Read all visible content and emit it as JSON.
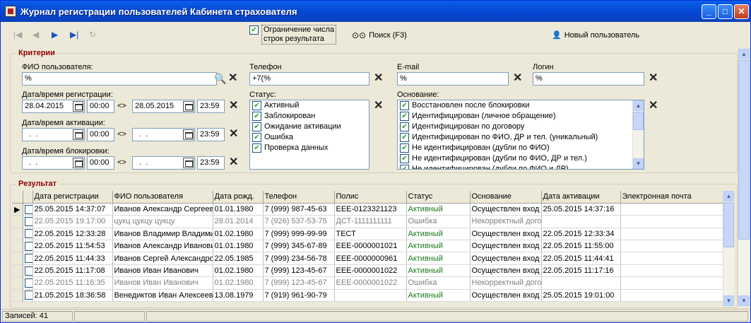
{
  "window": {
    "title": "Журнал регистрации пользователей Кабинета страхователя"
  },
  "toolbar": {
    "limit_label_1": "Ограничение числа",
    "limit_label_2": "строк результата",
    "limit_checked": true,
    "search_label": "Поиск (F3)",
    "new_user_label": "Новый пользователь"
  },
  "criteria": {
    "title": "Критерии",
    "fio_label": "ФИО пользователя:",
    "fio_value": "%",
    "phone_label": "Телефон",
    "phone_value": "+7(%",
    "email_label": "E-mail",
    "email_value": "%",
    "login_label": "Логин",
    "login_value": "%",
    "reg_label": "Дата/время регистрации:",
    "reg_from_date": "28.04.2015",
    "reg_from_time": "00:00",
    "reg_to_date": "28.05.2015",
    "reg_to_time": "23:59",
    "act_label": "Дата/время активации:",
    "act_from_date": "  .  .",
    "act_from_time": "00:00",
    "act_to_date": "  .  .",
    "act_to_time": "23:59",
    "block_label": "Дата/время блокировки:",
    "block_from_date": "  .  .",
    "block_from_time": "00:00",
    "block_to_date": "  .  .",
    "block_to_time": "23:59",
    "range_sep": "<>",
    "status_label": "Статус:",
    "statuses": [
      "Активный",
      "Заблокирован",
      "Ожидание активации",
      "Ошибка",
      "Проверка данных"
    ],
    "basis_label": "Основание:",
    "bases": [
      "Восстановлен после блокировки",
      "Идентифицирован (личное обращение)",
      "Идентифицирован по договору",
      "Идентифицирован по ФИО, ДР и тел. (уникальный)",
      "Не идентифицирован (дубли по ФИО)",
      "Не идентифицирован (дубли по ФИО, ДР и тел.)",
      "Не идентифицирован (дубли по ФИО и ДР)"
    ]
  },
  "result": {
    "title": "Результат",
    "columns": [
      "Дата регистрации",
      "ФИО пользователя",
      "Дата рожд.",
      "Телефон",
      "Полис",
      "Статус",
      "Основание",
      "Дата активации",
      "Электронная почта"
    ],
    "rows": [
      [
        "25.05.2015 14:37:07",
        "Иванов Александр Сергеевич",
        "01.01.1980",
        "7 (999) 987-45-63",
        "EEE-0123321123",
        "Активный",
        "Осуществлен вход",
        "25.05.2015 14:37:16",
        ""
      ],
      [
        "22.05.2015 19:17:00",
        "цукц цукцу цукцу",
        "28.01.2014",
        "7 (926) 537-53-75",
        "ДСТ-1111111111",
        "Ошибка",
        "Некорректный договор",
        "",
        ""
      ],
      [
        "22.05.2015 12:33:28",
        "Иванов Владимир Владимирович",
        "01.02.1980",
        "7 (999) 999-99-99",
        "ТЕСТ",
        "Активный",
        "Осуществлен вход",
        "22.05.2015 12:33:34",
        ""
      ],
      [
        "22.05.2015 11:54:53",
        "Иванов Александр Иванович",
        "01.01.1980",
        "7 (999) 345-67-89",
        "EEE-0000001021",
        "Активный",
        "Осуществлен вход",
        "22.05.2015 11:55:00",
        ""
      ],
      [
        "22.05.2015 11:44:33",
        "Иванов Сергей Александрович",
        "22.05.1985",
        "7 (999) 234-56-78",
        "EEE-0000000961",
        "Активный",
        "Осуществлен вход",
        "22.05.2015 11:44:41",
        ""
      ],
      [
        "22.05.2015 11:17:08",
        "Иванов Иван Иванович",
        "01.02.1980",
        "7 (999) 123-45-67",
        "EEE-0000001022",
        "Активный",
        "Осуществлен вход",
        "22.05.2015 11:17:16",
        ""
      ],
      [
        "22.05.2015 11:16:35",
        "Иванов Иван Иванович",
        "01.02.1980",
        "7 (999) 123-45-67",
        "EEE-0000001022",
        "Ошибка",
        "Некорректный договор",
        "",
        ""
      ],
      [
        "21.05.2015 18:36:58",
        "Венедиктов Иван Алексеевич",
        "13.08.1979",
        "7 (919) 961-90-79",
        "",
        "Активный",
        "Осуществлен вход",
        "25.05.2015 19:01:00",
        ""
      ]
    ]
  },
  "statusbar": {
    "records": "Записей: 41"
  },
  "colors": {
    "title_bar": "#0A5FE8",
    "group_title": "#8B0000",
    "active_status": "#1A7A1A",
    "inactive_row": "#808080"
  }
}
